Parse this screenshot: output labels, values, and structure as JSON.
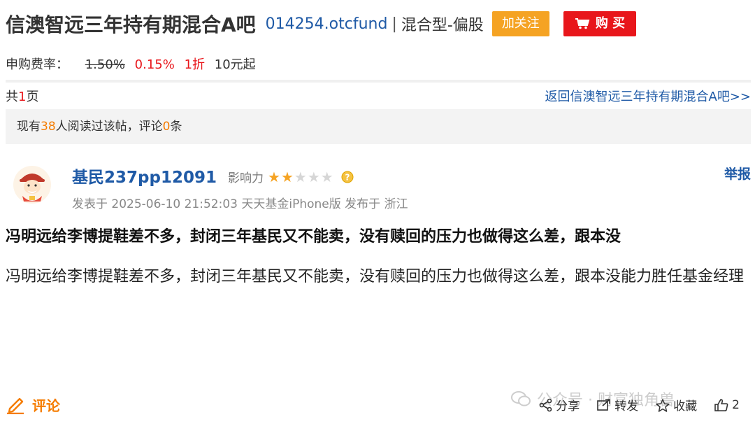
{
  "header": {
    "fund_name": "信澳智远三年持有期混合A吧",
    "fund_code": "014254.otcfund",
    "separator": "|",
    "fund_type": "混合型-偏股",
    "follow_label": "加关注",
    "buy_label": "购 买"
  },
  "fee": {
    "label": "申购费率：",
    "original_rate": "1.50%",
    "current_rate": "0.15%",
    "discount": "1折",
    "min_amount": "10元起"
  },
  "pagination": {
    "prefix": "共",
    "count": "1",
    "suffix": "页",
    "back_link": "返回信澳智远三年持有期混合A吧>>"
  },
  "read_stats": {
    "prefix": "现有",
    "readers": "38",
    "middle": "人阅读过该帖，评论",
    "comments": "0",
    "suffix": "条"
  },
  "post": {
    "username": "基民237pp12091",
    "influence_label": "影响力",
    "influence_stars": 2,
    "influence_max": 5,
    "report_label": "举报",
    "meta": "发表于 2025-06-10 21:52:03 天天基金iPhone版 发布于 浙江",
    "title": "冯明远给李博提鞋差不多，封闭三年基民又不能卖，没有赎回的压力也做得这么差，跟本没",
    "body": "冯明远给李博提鞋差不多，封闭三年基民又不能卖，没有赎回的压力也做得这么差，跟本没能力胜任基金经理"
  },
  "footer": {
    "comment_label": "评论",
    "share_label": "分享",
    "forward_label": "转发",
    "favorite_label": "收藏",
    "like_count": "2"
  },
  "watermark": {
    "text": "公众号 · 财富独角兽"
  },
  "colors": {
    "brand_blue": "#1f5aa6",
    "follow_orange": "#f5a323",
    "buy_red": "#e8161b",
    "accent_orange": "#f57c00"
  }
}
